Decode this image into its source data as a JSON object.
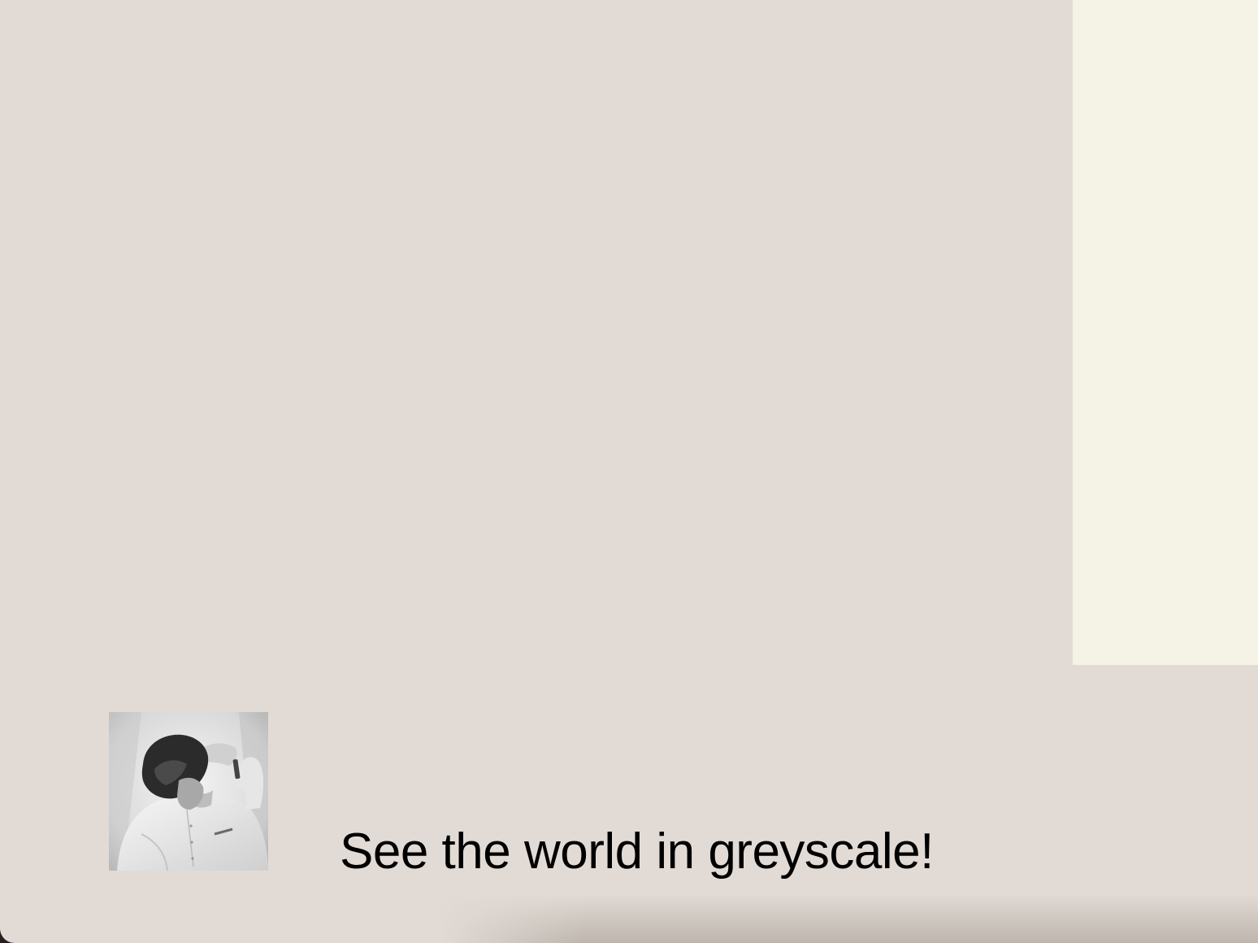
{
  "photo": {
    "icon": "greyscale-portrait-photo"
  },
  "tagline": {
    "text": "See the world in greyscale!"
  },
  "colors": {
    "background": "#e2dbd5",
    "side_panel": "#f5f3e6",
    "text": "#000000"
  }
}
